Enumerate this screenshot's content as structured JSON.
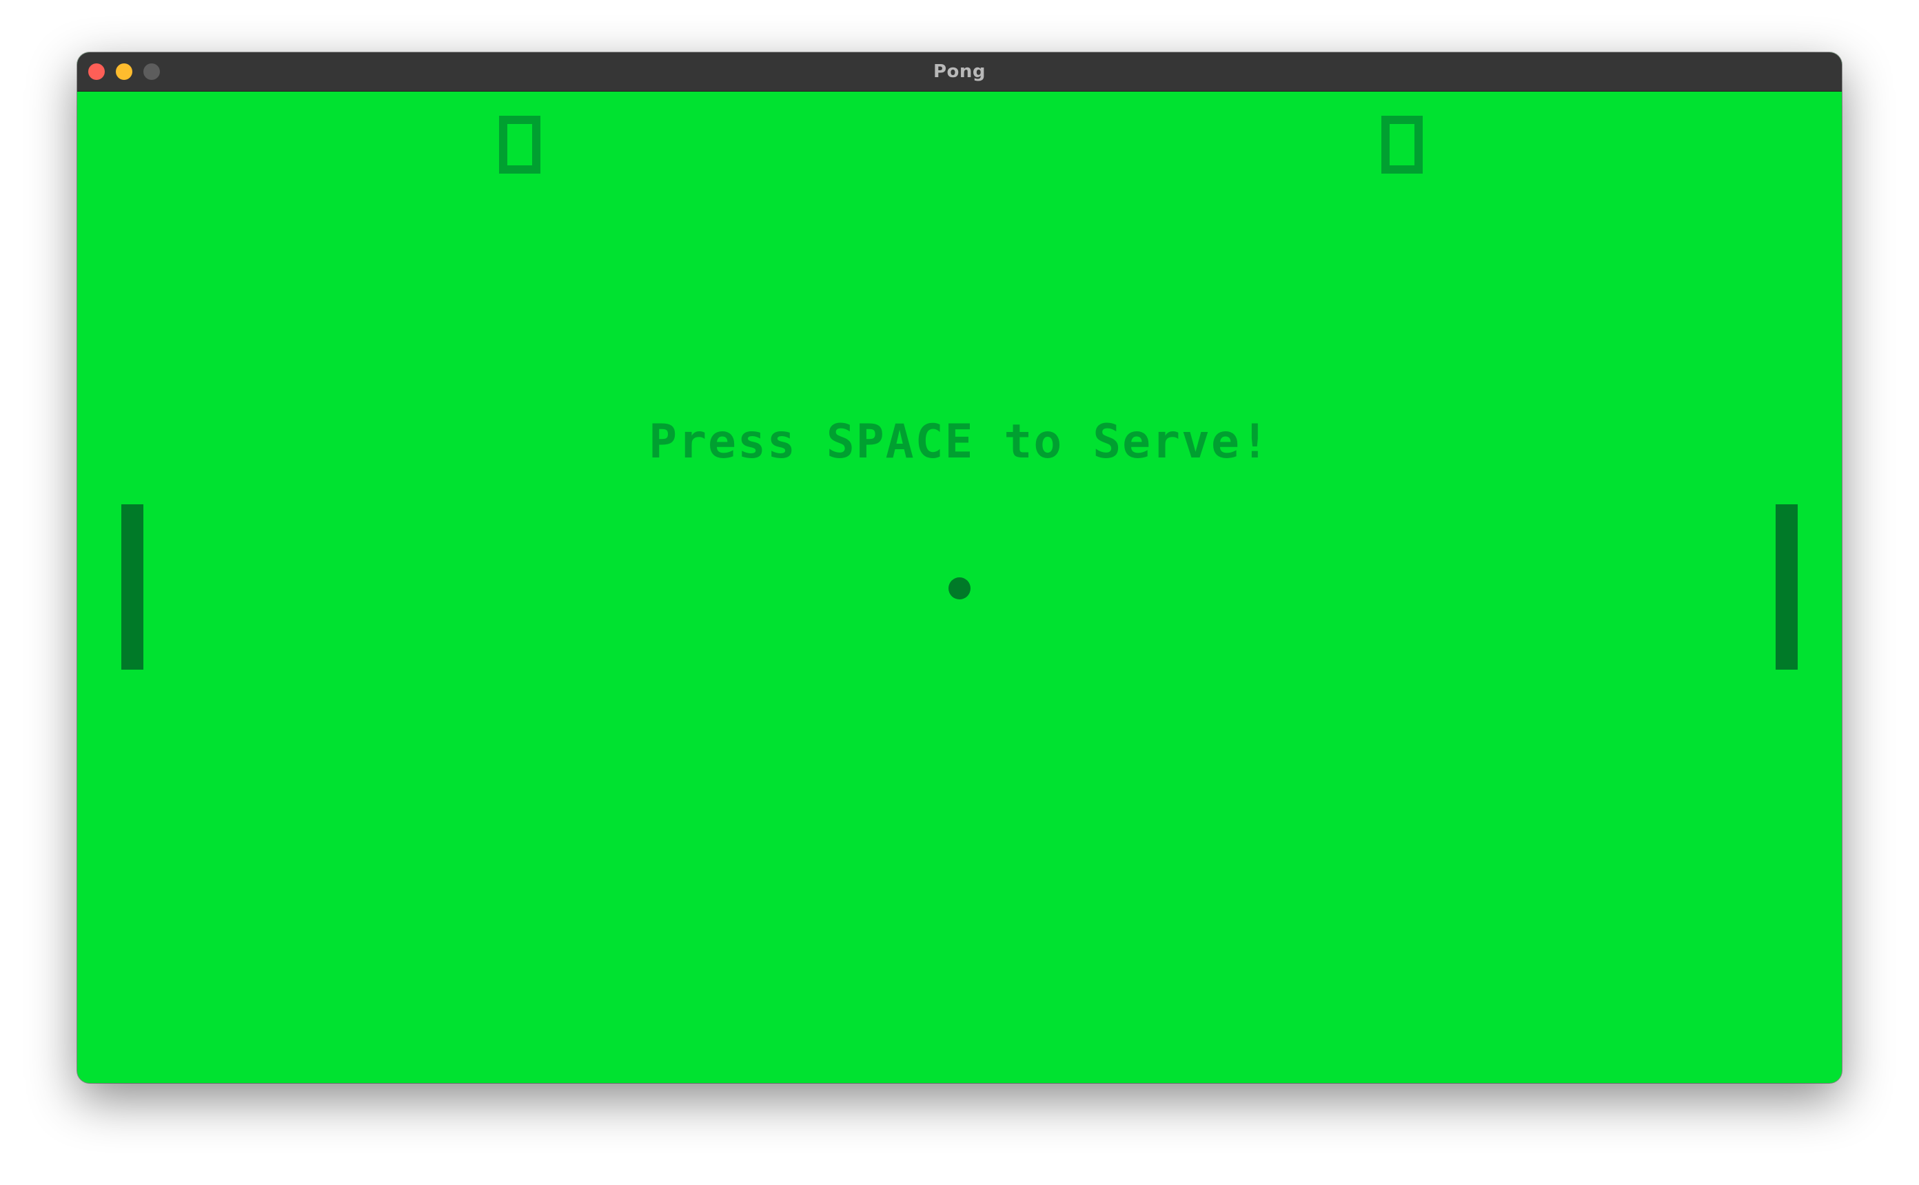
{
  "window": {
    "title": "Pong",
    "colors": {
      "titlebar": "#363636",
      "close": "#fe5f57",
      "minimize": "#febc2e",
      "zoom": "#5d5d5d"
    }
  },
  "game": {
    "background": "#00e230",
    "scores": {
      "left": "0",
      "right": "0"
    },
    "message": "Press SPACE to Serve!",
    "colors": {
      "text": "#00a030",
      "paddles": "#007a28",
      "ball": "#007a28"
    }
  }
}
